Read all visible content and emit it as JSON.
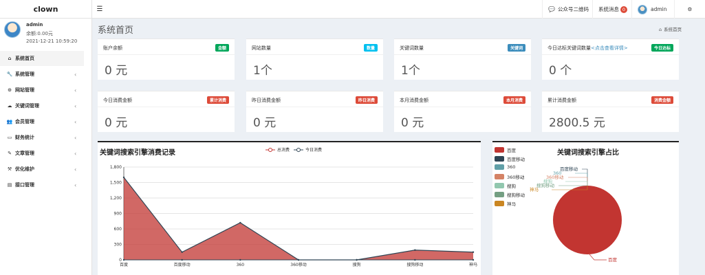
{
  "header": {
    "logo": "clown",
    "menu_icon": "hamburger-icon",
    "wechat_label": "公众号二维码",
    "messages_label": "系统消息",
    "messages_count": "0",
    "user_name": "admin"
  },
  "sidebar": {
    "user_name": "admin",
    "balance": "余额:0.00元",
    "datetime": "2021-12-21 10:59:20",
    "items": [
      {
        "label": "系统首页",
        "icon": "home-icon"
      },
      {
        "label": "系统管理",
        "icon": "wrench-icon"
      },
      {
        "label": "网站管理",
        "icon": "circle-icon"
      },
      {
        "label": "关键词管理",
        "icon": "cloud-icon"
      },
      {
        "label": "会员管理",
        "icon": "users-icon"
      },
      {
        "label": "财务统计",
        "icon": "card-icon"
      },
      {
        "label": "文章管理",
        "icon": "edit-icon"
      },
      {
        "label": "优化维护",
        "icon": "gavel-icon"
      },
      {
        "label": "接口管理",
        "icon": "book-icon"
      }
    ]
  },
  "page": {
    "title": "系统首页",
    "breadcrumb": "系统首页"
  },
  "cards": [
    {
      "title": "账户余额",
      "badge": "金额",
      "badge_color": "#00a65a",
      "value": "0 元"
    },
    {
      "title": "网站数量",
      "badge": "数量",
      "badge_color": "#00c0ef",
      "value": "1个"
    },
    {
      "title": "关键词数量",
      "badge": "关键词",
      "badge_color": "#3c8dbc",
      "value": "1个"
    },
    {
      "title": "今日达标关键词数量",
      "title_link": "<点击查看详情>",
      "badge": "今日达标",
      "badge_color": "#00a65a",
      "value": "0 个"
    },
    {
      "title": "今日消费金额",
      "badge": "累计消费",
      "badge_color": "#dd4b39",
      "value": "0 元"
    },
    {
      "title": "昨日消费金额",
      "badge": "昨日消费",
      "badge_color": "#dd4b39",
      "value": "0 元"
    },
    {
      "title": "本月消费金额",
      "badge": "本月消费",
      "badge_color": "#dd4b39",
      "value": "0 元"
    },
    {
      "title": "累计消费金额",
      "badge": "消费金额",
      "badge_color": "#dd4b39",
      "value": "2800.5 元"
    }
  ],
  "chart_data": [
    {
      "type": "area",
      "title": "关键词搜索引擎消费记录",
      "categories": [
        "百度",
        "百度移动",
        "360",
        "360移动",
        "搜狗",
        "搜狗移动",
        "神马"
      ],
      "series": [
        {
          "name": "总消费",
          "values": [
            1600,
            150,
            720,
            0,
            0,
            190,
            150
          ],
          "color": "#c23531"
        },
        {
          "name": "今日消费",
          "values": [
            0,
            0,
            0,
            0,
            0,
            0,
            0
          ],
          "color": "#2f4554"
        }
      ],
      "ylim": [
        0,
        1800
      ],
      "yticks": [
        0,
        300,
        600,
        900,
        1200,
        1500,
        1800
      ],
      "ytick_labels": [
        "0",
        "300",
        "600",
        "900",
        "1,200",
        "1,500",
        "1,800"
      ],
      "grid": true,
      "legend_position": "top-right"
    },
    {
      "type": "pie",
      "title": "关键词搜索引擎占比",
      "slices": [
        {
          "name": "百度",
          "value": 100,
          "color": "#c23531"
        },
        {
          "name": "百度移动",
          "value": 0,
          "color": "#2f4554"
        },
        {
          "name": "360",
          "value": 0,
          "color": "#61a0a8"
        },
        {
          "name": "360移动",
          "value": 0,
          "color": "#d48265"
        },
        {
          "name": "搜狗",
          "value": 0,
          "color": "#91c7ae"
        },
        {
          "name": "搜狗移动",
          "value": 0,
          "color": "#749f83"
        },
        {
          "name": "神马",
          "value": 0,
          "color": "#ca8622"
        }
      ],
      "legend_position": "left"
    }
  ]
}
